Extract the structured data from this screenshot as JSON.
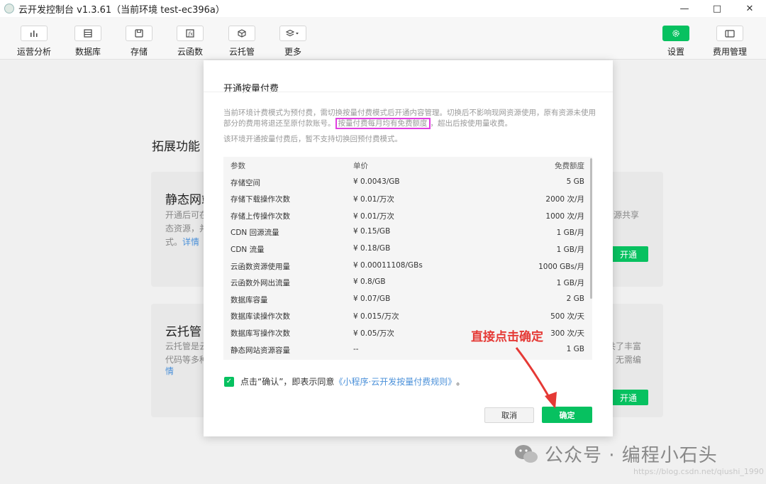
{
  "window": {
    "title": "云开发控制台 v1.3.61（当前环境 test-ec396a）",
    "minimize": "—",
    "maximize": "□",
    "close": "✕"
  },
  "toolbar": {
    "items": [
      {
        "label": "运营分析",
        "icon": "bar-chart-icon"
      },
      {
        "label": "数据库",
        "icon": "database-icon"
      },
      {
        "label": "存储",
        "icon": "storage-icon"
      },
      {
        "label": "云函数",
        "icon": "function-icon"
      },
      {
        "label": "云托管",
        "icon": "cube-icon"
      },
      {
        "label": "更多",
        "icon": "layers-icon"
      }
    ],
    "right": [
      {
        "label": "设置",
        "icon": "gear-icon"
      },
      {
        "label": "费用管理",
        "icon": "billing-icon"
      }
    ]
  },
  "background": {
    "section_title": "拓展功能",
    "card1": {
      "title": "静态网站",
      "text_lines": [
        "开通后可在",
        "态资源，并",
        "式。"
      ],
      "link": "详情",
      "right_text": "资源共享",
      "button": "开通"
    },
    "card2": {
      "title": "云托管",
      "text_lines": [
        "云托管是云",
        "代码等多种",
        "情"
      ],
      "right_text_1": "共了丰富",
      "right_text_2": "，无需编",
      "button": "开通"
    }
  },
  "dialog": {
    "title": "开通按量付费",
    "desc_before": "当前环境计费模式为预付费，需切换按量付费模式后开通内容管理。切换后不影响现网资源使用，原有资源未使用部分的费用将退还至原付款账号。",
    "desc_highlight": "按量付费每月均有免费额度",
    "desc_after": "，超出后按使用量收费。",
    "desc2": "该环境开通按量付费后，暂不支持切换回预付费模式。",
    "table": {
      "headers": [
        "参数",
        "单价",
        "免费额度"
      ],
      "rows": [
        [
          "存储空间",
          "¥ 0.0043/GB",
          "5 GB"
        ],
        [
          "存储下载操作次数",
          "¥ 0.01/万次",
          "2000 次/月"
        ],
        [
          "存储上传操作次数",
          "¥ 0.01/万次",
          "1000 次/月"
        ],
        [
          "CDN 回源流量",
          "¥ 0.15/GB",
          "1 GB/月"
        ],
        [
          "CDN 流量",
          "¥ 0.18/GB",
          "1 GB/月"
        ],
        [
          "云函数资源使用量",
          "¥ 0.00011108/GBs",
          "1000 GBs/月"
        ],
        [
          "云函数外网出流量",
          "¥ 0.8/GB",
          "1 GB/月"
        ],
        [
          "数据库容量",
          "¥ 0.07/GB",
          "2 GB"
        ],
        [
          "数据库读操作次数",
          "¥ 0.015/万次",
          "500 次/天"
        ],
        [
          "数据库写操作次数",
          "¥ 0.05/万次",
          "300 次/天"
        ],
        [
          "静态网站资源容量",
          "--",
          "1 GB"
        ]
      ]
    },
    "agree_prefix": "点击“确认”，即表示同意",
    "agree_link": "《小程序·云开发按量付费规则》",
    "agree_suffix": "。",
    "cancel": "取消",
    "confirm": "确定"
  },
  "annotation": "直接点击确定",
  "watermark": {
    "text": "公众号 · 编程小石头",
    "url": "https://blog.csdn.net/qiushi_1990"
  },
  "colors": {
    "accent": "#07c160",
    "annotation": "#e53935",
    "highlight_box": "#e040e0",
    "link": "#4a90d9"
  }
}
